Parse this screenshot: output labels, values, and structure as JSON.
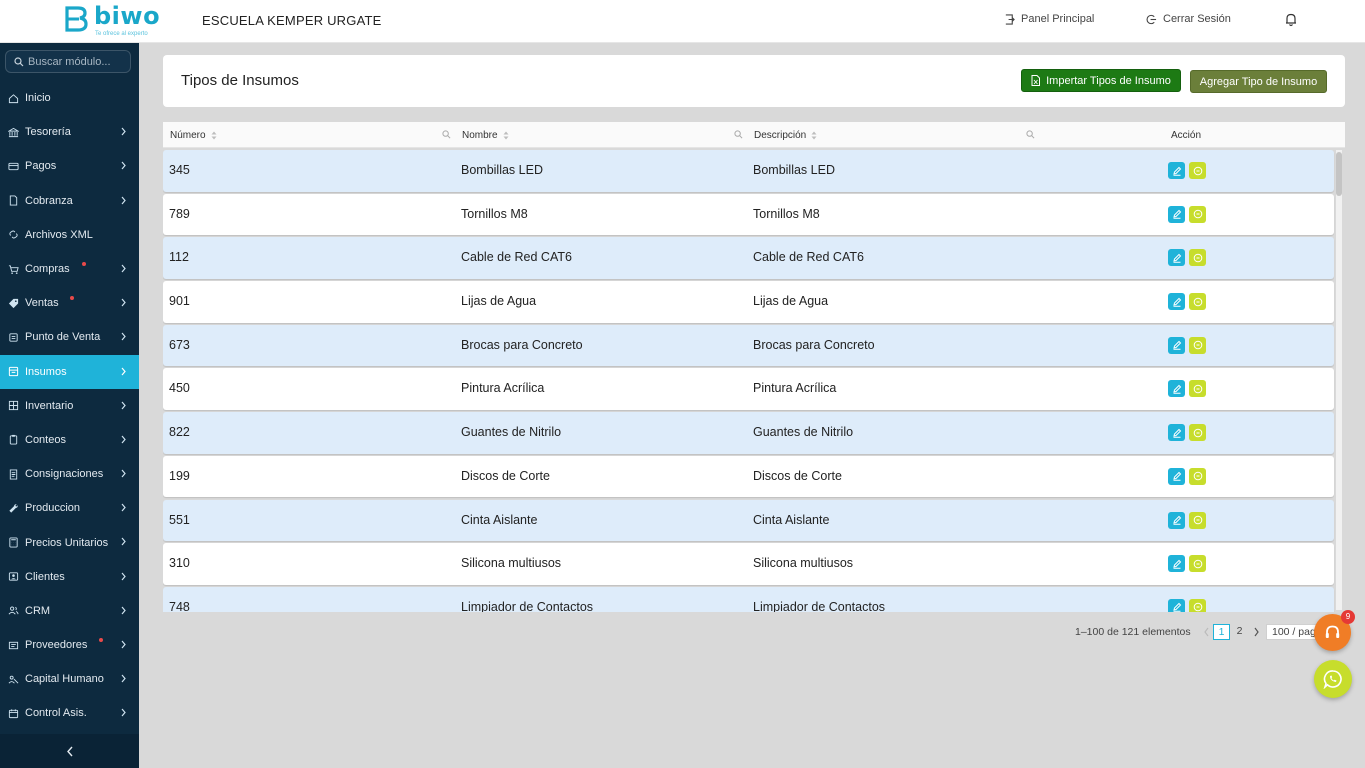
{
  "app": {
    "brand": "biwo",
    "tagline": "Te ofrece al experto",
    "company": "ESCUELA KEMPER URGATE",
    "brand_color": "#1aa7c9"
  },
  "topbar": {
    "panel_label": "Panel Principal",
    "logout_label": "Cerrar Sesión"
  },
  "sidebar": {
    "search_placeholder": "Buscar módulo...",
    "items": [
      {
        "label": "Inicio",
        "icon": "home-icon",
        "has_chevron": false
      },
      {
        "label": "Tesorería",
        "icon": "bank-icon",
        "has_chevron": true
      },
      {
        "label": "Pagos",
        "icon": "credit-card-icon",
        "has_chevron": true
      },
      {
        "label": "Cobranza",
        "icon": "file-icon",
        "has_chevron": true
      },
      {
        "label": "Archivos XML",
        "icon": "link-icon",
        "has_chevron": false
      },
      {
        "label": "Compras",
        "icon": "cart-icon",
        "has_chevron": true,
        "dot": true
      },
      {
        "label": "Ventas",
        "icon": "tag-icon",
        "has_chevron": true,
        "dot": true
      },
      {
        "label": "Punto de Venta",
        "icon": "register-icon",
        "has_chevron": true
      },
      {
        "label": "Insumos",
        "icon": "box-icon",
        "has_chevron": true,
        "active": true
      },
      {
        "label": "Inventario",
        "icon": "inventory-icon",
        "has_chevron": true
      },
      {
        "label": "Conteos",
        "icon": "clipboard-icon",
        "has_chevron": true
      },
      {
        "label": "Consignaciones",
        "icon": "document-icon",
        "has_chevron": true
      },
      {
        "label": "Produccion",
        "icon": "wrench-icon",
        "has_chevron": true
      },
      {
        "label": "Precios Unitarios",
        "icon": "calculator-icon",
        "has_chevron": true
      },
      {
        "label": "Clientes",
        "icon": "contacts-icon",
        "has_chevron": true
      },
      {
        "label": "CRM",
        "icon": "users-icon",
        "has_chevron": true
      },
      {
        "label": "Proveedores",
        "icon": "supplier-icon",
        "has_chevron": true,
        "dot": true
      },
      {
        "label": "Capital Humano",
        "icon": "people-icon",
        "has_chevron": true
      },
      {
        "label": "Control Asis.",
        "icon": "calendar-icon",
        "has_chevron": true
      }
    ]
  },
  "main": {
    "title": "Tipos de Insumos",
    "import_button": "Impertar Tipos de Insumo",
    "add_button": "Agregar Tipo de Insumo",
    "table": {
      "headers": {
        "numero": "Número",
        "nombre": "Nombre",
        "descripcion": "Descripción",
        "accion": "Acción"
      },
      "rows": [
        {
          "numero": "345",
          "nombre": "Bombillas LED",
          "descripcion": "Bombillas LED"
        },
        {
          "numero": "789",
          "nombre": "Tornillos M8",
          "descripcion": "Tornillos M8"
        },
        {
          "numero": "112",
          "nombre": "Cable de Red CAT6",
          "descripcion": "Cable de Red CAT6"
        },
        {
          "numero": "901",
          "nombre": "Lijas de Agua",
          "descripcion": "Lijas de Agua"
        },
        {
          "numero": "673",
          "nombre": "Brocas para Concreto",
          "descripcion": "Brocas para Concreto"
        },
        {
          "numero": "450",
          "nombre": "Pintura Acrílica",
          "descripcion": "Pintura Acrílica"
        },
        {
          "numero": "822",
          "nombre": "Guantes de Nitrilo",
          "descripcion": "Guantes de Nitrilo"
        },
        {
          "numero": "199",
          "nombre": "Discos de Corte",
          "descripcion": "Discos de Corte"
        },
        {
          "numero": "551",
          "nombre": "Cinta Aislante",
          "descripcion": "Cinta Aislante"
        },
        {
          "numero": "310",
          "nombre": "Silicona multiusos",
          "descripcion": "Silicona multiusos"
        },
        {
          "numero": "748",
          "nombre": "Limpiador de Contactos",
          "descripcion": "Limpiador de Contactos"
        }
      ]
    },
    "pagination": {
      "total_text": "1–100 de 121 elementos",
      "pages": [
        "1",
        "2"
      ],
      "current_page": "1",
      "page_size": "100 / page"
    }
  },
  "floating": {
    "support_badge": "9"
  },
  "colors": {
    "sidebar_bg": "#0d2a3f",
    "active": "#1fb3d9",
    "import_btn": "#1d7a14",
    "add_btn": "#6b7f3a",
    "row_blue": "#deecfa",
    "delete_btn": "#c7dd2c",
    "support_fab": "#f07d26"
  }
}
